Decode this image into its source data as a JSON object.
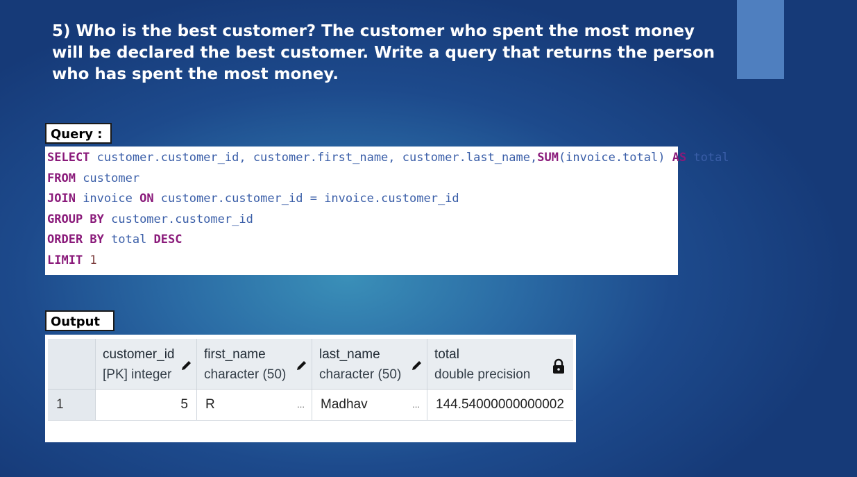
{
  "slide": {
    "heading": "5) Who is the best customer? The customer who spent the most money will be declared the best customer. Write a query that returns the person who has spent the most money.",
    "query_label": "Query :",
    "output_label": "Output :",
    "accent_color": "#4f7fbf"
  },
  "query": {
    "line1": {
      "kw1": "SELECT",
      "rest1": " customer.customer_id, customer.first_name, customer.last_name,",
      "kw2": "SUM",
      "rest2": "(invoice.total) ",
      "kw3": "AS",
      "rest3": " total"
    },
    "line2": {
      "kw1": "FROM",
      "rest1": " customer"
    },
    "line3": {
      "kw1": "JOIN",
      "rest1": " invoice ",
      "kw2": "ON",
      "rest2": " customer.customer_id = invoice.customer_id"
    },
    "line4": {
      "kw1": "GROUP BY",
      "rest1": " customer.customer_id"
    },
    "line5": {
      "kw1": "ORDER BY",
      "rest1": " total ",
      "kw2": "DESC"
    },
    "line6": {
      "kw1": "LIMIT",
      "num": " 1"
    }
  },
  "result": {
    "columns": [
      {
        "name": "customer_id",
        "type": "[PK] integer",
        "icon": "pencil-icon"
      },
      {
        "name": "first_name",
        "type": "character (50)",
        "icon": "pencil-icon"
      },
      {
        "name": "last_name",
        "type": "character (50)",
        "icon": "pencil-icon"
      },
      {
        "name": "total",
        "type": "double precision",
        "icon": "lock-icon"
      }
    ],
    "rows": [
      {
        "row_number": "1",
        "customer_id": "5",
        "first_name": "R",
        "last_name": "Madhav",
        "total": "144.54000000000002",
        "more": "..."
      }
    ]
  }
}
